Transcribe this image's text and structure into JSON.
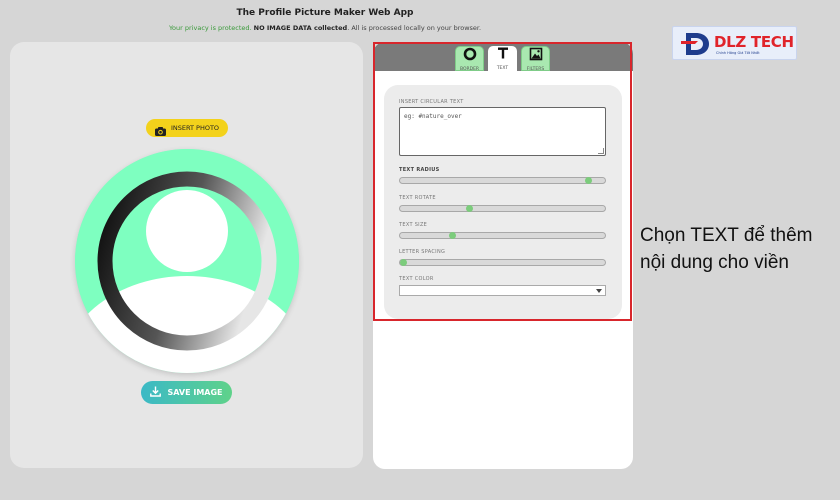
{
  "app": {
    "title": "The Profile Picture Maker Web App",
    "privacy_green": "Your privacy is protected.",
    "privacy_bold": "NO IMAGE DATA collected",
    "privacy_rest": ". All is processed locally on your browser."
  },
  "left": {
    "insert_label": "INSERT PHOTO",
    "save_label": "SAVE IMAGE"
  },
  "tabs": [
    {
      "label": "BORDER",
      "icon": "ring-icon"
    },
    {
      "label": "TEXT",
      "icon": "text-t-icon"
    },
    {
      "label": "FILTERS",
      "icon": "image-icon"
    }
  ],
  "text_settings": {
    "circular_label": "INSERT CIRCULAR TEXT",
    "circular_placeholder": "eg: #nature_over",
    "radius_label": "TEXT RADIUS",
    "radius_value": 0.92,
    "rotate_label": "TEXT ROTATE",
    "rotate_value": 0.34,
    "size_label": "TEXT SIZE",
    "size_value": 0.26,
    "spacing_label": "LETTER SPACING",
    "spacing_value": 0.02,
    "color_label": "TEXT COLOR",
    "color_value": ""
  },
  "annotation": {
    "line1": "Chọn TEXT để thêm",
    "line2": "nội dung cho viền"
  },
  "logo": {
    "name": "DLZ TECH",
    "tagline": "Chính Hãng Giá Tốt Nhất"
  },
  "colors": {
    "accent_green": "#7effc0",
    "insert_yellow": "#f3d21b",
    "highlight_red": "#d8262c",
    "slider_thumb": "#7ccc7c"
  }
}
